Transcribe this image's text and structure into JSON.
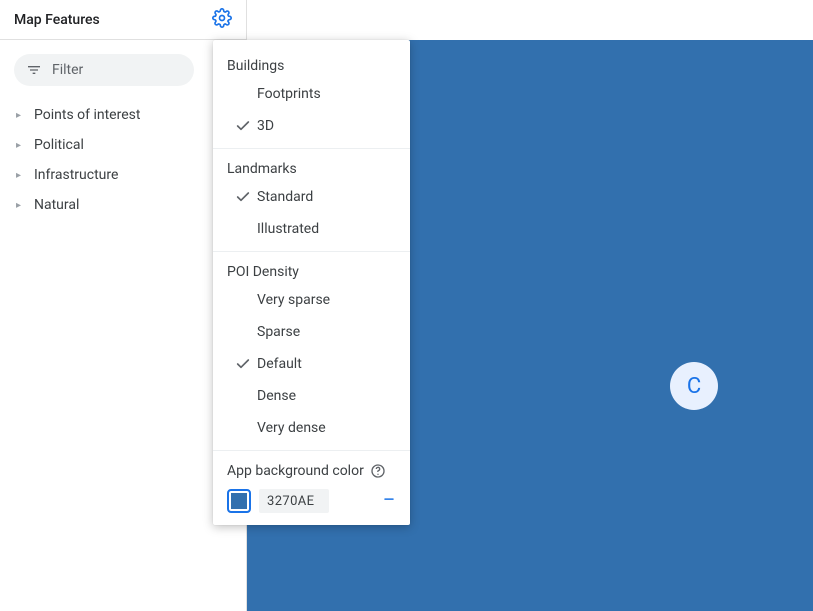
{
  "sidebar": {
    "title": "Map Features",
    "filter_label": "Filter",
    "tree": [
      {
        "label": "Points of interest"
      },
      {
        "label": "Political"
      },
      {
        "label": "Infrastructure"
      },
      {
        "label": "Natural"
      }
    ]
  },
  "popover": {
    "groups": [
      {
        "title": "Buildings",
        "options": [
          {
            "label": "Footprints",
            "selected": false
          },
          {
            "label": "3D",
            "selected": true
          }
        ]
      },
      {
        "title": "Landmarks",
        "options": [
          {
            "label": "Standard",
            "selected": true
          },
          {
            "label": "Illustrated",
            "selected": false
          }
        ]
      },
      {
        "title": "POI Density",
        "options": [
          {
            "label": "Very sparse",
            "selected": false
          },
          {
            "label": "Sparse",
            "selected": false
          },
          {
            "label": "Default",
            "selected": true
          },
          {
            "label": "Dense",
            "selected": false
          },
          {
            "label": "Very dense",
            "selected": false
          }
        ]
      }
    ],
    "bgcolor_label": "App background color",
    "bgcolor_hex": "3270AE",
    "bgcolor_value": "#3270AE"
  },
  "map": {
    "center_marker": "C",
    "background_color": "#3270AE"
  }
}
